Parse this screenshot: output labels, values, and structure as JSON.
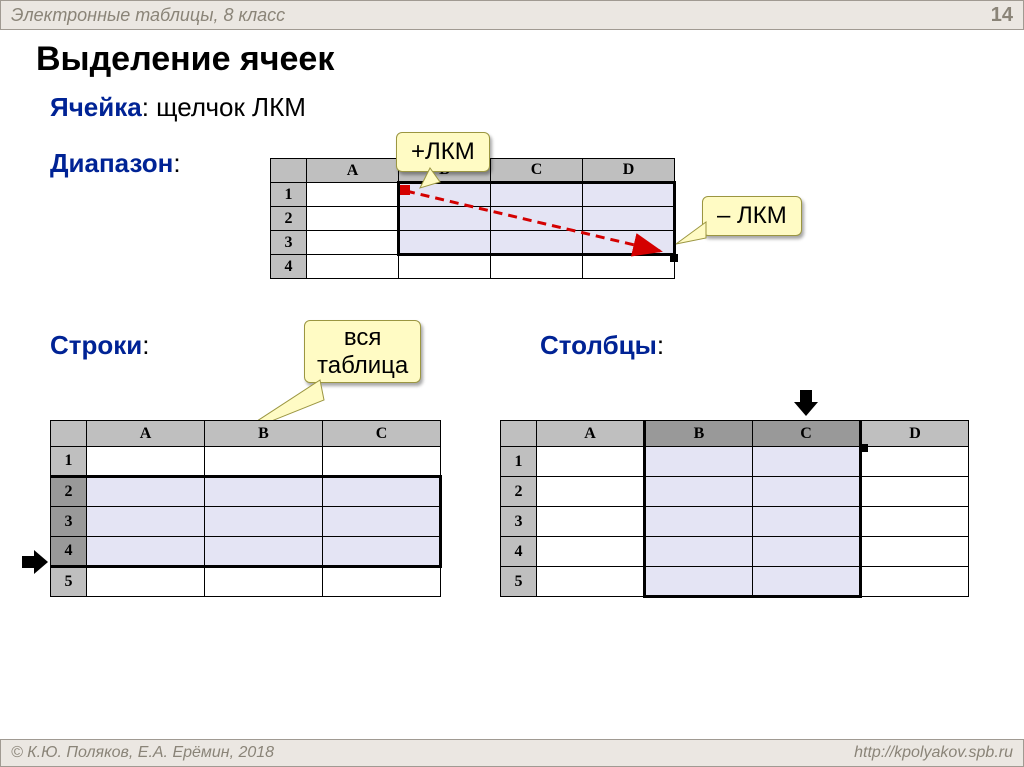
{
  "header": {
    "subject": "Электронные таблицы, 8 класс",
    "page": "14"
  },
  "footer": {
    "copyright": "© К.Ю. Поляков, Е.А. Ерёмин, 2018",
    "url": "http://kpolyakov.spb.ru"
  },
  "title": "Выделение ячеек",
  "lines": {
    "cell_kw": "Ячейка",
    "cell_rest": ": щелчок ЛКМ",
    "range_kw": "Диапазон",
    "range_rest": ":",
    "rows_kw": "Строки",
    "rows_rest": ":",
    "cols_kw": "Столбцы",
    "cols_rest": ":"
  },
  "callouts": {
    "plus": "+ЛКМ",
    "minus": "– ЛКМ",
    "whole": "вся\nтаблица"
  },
  "grid_top": {
    "cols": [
      "A",
      "B",
      "C",
      "D"
    ],
    "rows": [
      "1",
      "2",
      "3",
      "4"
    ]
  },
  "grid_rows": {
    "cols": [
      "A",
      "B",
      "C"
    ],
    "rows": [
      "1",
      "2",
      "3",
      "4",
      "5"
    ]
  },
  "grid_cols": {
    "cols": [
      "A",
      "B",
      "C",
      "D"
    ],
    "rows": [
      "1",
      "2",
      "3",
      "4",
      "5"
    ]
  }
}
